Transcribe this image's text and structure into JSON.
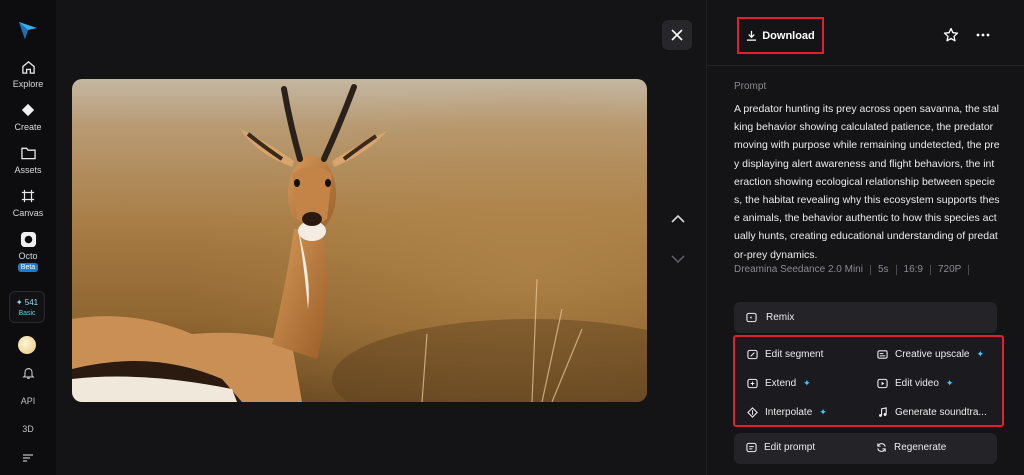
{
  "sidebar": {
    "items": [
      {
        "label": "Explore",
        "icon": "home-icon"
      },
      {
        "label": "Create",
        "icon": "diamond-icon"
      },
      {
        "label": "Assets",
        "icon": "folder-icon"
      },
      {
        "label": "Canvas",
        "icon": "canvas-icon"
      },
      {
        "label": "Octo",
        "icon": "octo-icon",
        "badge": "Beta"
      }
    ],
    "credits": {
      "value": "541",
      "tier": "Basic"
    },
    "bottom": {
      "api": "API",
      "three_d": "3D"
    }
  },
  "panel": {
    "download_label": "Download",
    "prompt_label": "Prompt",
    "prompt_text": "A predator hunting its prey across open savanna, the stalking behavior showing calculated patience, the predator moving with purpose while remaining undetected, the prey displaying alert awareness and flight behaviors, the interaction showing ecological relationship between species, the habitat revealing why this ecosystem supports these animals, the behavior authentic to how this species actually hunts, creating educational understanding of predator-prey dynamics.",
    "meta": {
      "model": "Dreamina Seedance 2.0 Mini",
      "duration": "5s",
      "ratio": "16:9",
      "resolution": "720P"
    },
    "remix_label": "Remix",
    "actions": {
      "edit_segment": "Edit segment",
      "creative_upscale": "Creative upscale",
      "extend": "Extend",
      "edit_video": "Edit video",
      "interpolate": "Interpolate",
      "generate_soundtrack": "Generate soundtra..."
    },
    "edit_prompt_label": "Edit prompt",
    "regenerate_label": "Regenerate",
    "spark_glyph": "✦"
  },
  "colors": {
    "accent": "#3ec7ff",
    "highlight": "#e0202a"
  }
}
